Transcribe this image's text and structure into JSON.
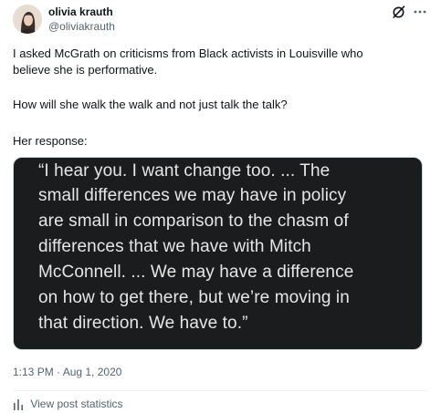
{
  "author": {
    "name": "olivia krauth",
    "handle": "@oliviakrauth"
  },
  "icons": {
    "avatar": "profile-photo",
    "grok": "grok-slash-circle-icon",
    "more": "more-horizontal-icon",
    "stats": "bar-chart-icon"
  },
  "tweet": {
    "paragraphs": [
      "I asked McGrath on criticisms from Black activists in Louisville who",
      "believe she is performative.",
      "How will she walk the walk and not just talk the talk?",
      "Her response:"
    ]
  },
  "media": {
    "quote_lines": [
      "“I hear you. I want change too. ... The",
      "small differences we may have in policy",
      "are small in comparison to the chasm of",
      "differences that we have with Mitch",
      "McConnell. ... We may have a difference",
      "on how to get there, but we’re moving in",
      "that direction. We have to.”"
    ]
  },
  "timestamp": "1:13 PM · Aug 1, 2020",
  "stats_link": "View post statistics",
  "colors": {
    "text": "#0f1419",
    "secondary": "#536471",
    "media_bg": "#1b1c1e",
    "media_text": "#e6e6e6"
  }
}
